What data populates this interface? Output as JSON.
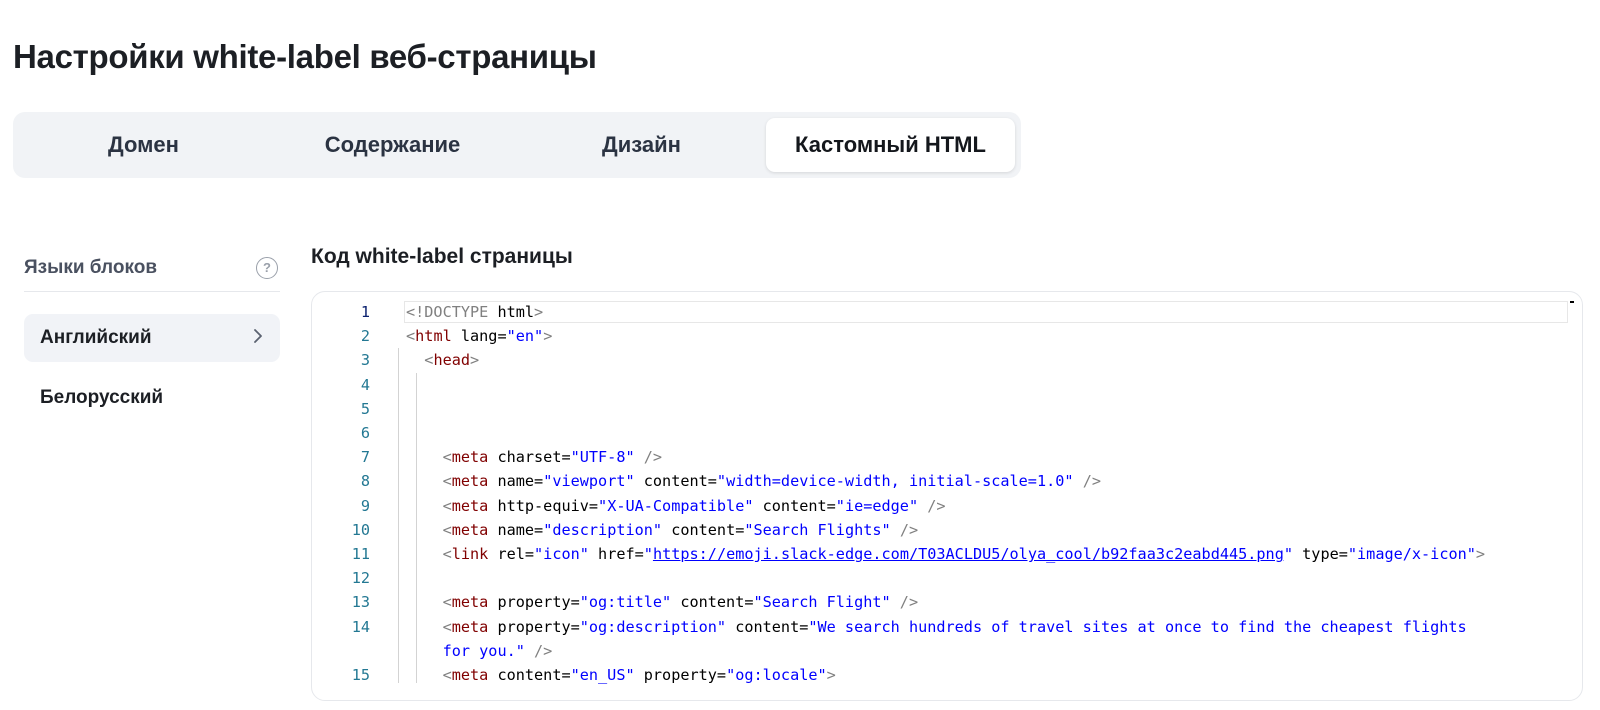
{
  "page": {
    "title": "Настройки white-label веб-страницы"
  },
  "tabs": [
    {
      "label": "Домен",
      "active": false
    },
    {
      "label": "Содержание",
      "active": false
    },
    {
      "label": "Дизайн",
      "active": false
    },
    {
      "label": "Кастомный HTML",
      "active": true
    }
  ],
  "sidebar": {
    "header": "Языки блоков",
    "help_icon": "question-circle-icon",
    "items": [
      {
        "label": "Английский",
        "active": true,
        "icon": "chevron-right-icon"
      },
      {
        "label": "Белорусский",
        "active": false
      }
    ]
  },
  "editor": {
    "title": "Код white-label страницы",
    "current_line": 1,
    "line_numbers": [
      "1",
      "2",
      "3",
      "4",
      "5",
      "6",
      "7",
      "8",
      "9",
      "10",
      "11",
      "12",
      "13",
      "14",
      "",
      "15"
    ],
    "lines": [
      "<!DOCTYPE html>",
      "<html lang=\"en\">",
      "  <head>",
      "",
      "",
      "",
      "    <meta charset=\"UTF-8\" />",
      "    <meta name=\"viewport\" content=\"width=device-width, initial-scale=1.0\" />",
      "    <meta http-equiv=\"X-UA-Compatible\" content=\"ie=edge\" />",
      "    <meta name=\"description\" content=\"Search Flights\" />",
      "    <link rel=\"icon\" href=\"https://emoji.slack-edge.com/T03ACLDU5/olya_cool/b92faa3c2eabd445.png\" type=\"image/x-icon\">",
      "",
      "    <meta property=\"og:title\" content=\"Search Flight\" />",
      "    <meta property=\"og:description\" content=\"We search hundreds of travel sites at once to find the cheapest flights",
      "    for you.\" />",
      "    <meta content=\"en_US\" property=\"og:locale\">"
    ],
    "colors": {
      "tag": "#800000",
      "attribute": "#e50000",
      "string": "#0000ff",
      "doctype": "#808080",
      "line_number": "#237893"
    }
  }
}
